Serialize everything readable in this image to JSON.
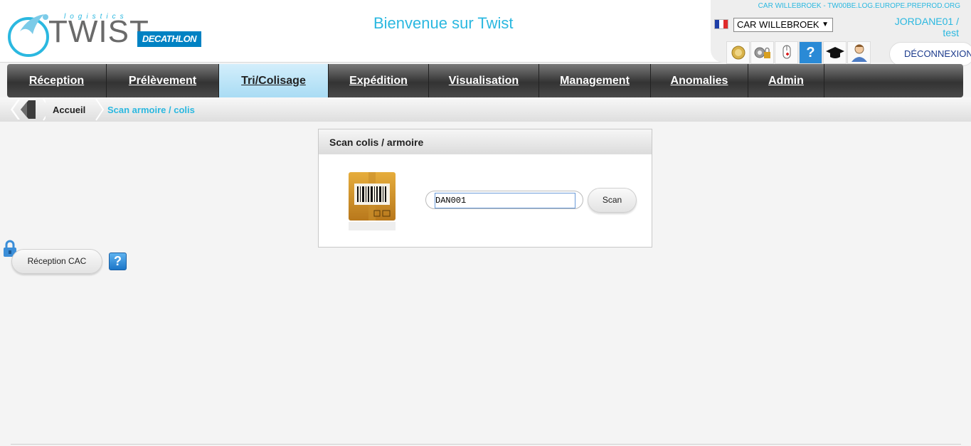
{
  "header": {
    "logo_text": "TWIST",
    "logo_subtext": "logistics",
    "brand": "DECATHLON",
    "welcome": "Bienvenue sur Twist",
    "server_info": "CAR WILLEBROEK - TW00BE.LOG.EUROPE.PREPROD.ORG",
    "site_select": "CAR WILLEBROEK",
    "user_line1": "JORDANE01 /",
    "user_line2": "test",
    "logout": "DÉCONNEXION",
    "flag_colors": [
      "#1f3fa8",
      "#ffffff",
      "#e02b2b"
    ],
    "tool_icons": [
      "badge-icon",
      "settings-lock-icon",
      "mouse-icon",
      "help-icon",
      "graduation-cap-icon",
      "user-icon"
    ]
  },
  "nav": {
    "items": [
      {
        "label": "Réception"
      },
      {
        "label": "Prélèvement"
      },
      {
        "label": "Tri/Colisage",
        "active": true
      },
      {
        "label": "Expédition"
      },
      {
        "label": "Visualisation"
      },
      {
        "label": "Management"
      },
      {
        "label": "Anomalies"
      },
      {
        "label": "Admin"
      }
    ]
  },
  "breadcrumb": {
    "home": "Accueil",
    "current": "Scan armoire / colis"
  },
  "panel": {
    "title": "Scan colis / armoire",
    "input_value": "DAN001",
    "scan_button": "Scan"
  },
  "actions": {
    "reception_cac": "Réception CAC",
    "help": "?"
  },
  "colors": {
    "accent": "#2bb8e0",
    "nav_active": "#a9dcf4",
    "brand_blue": "#0082c3"
  }
}
